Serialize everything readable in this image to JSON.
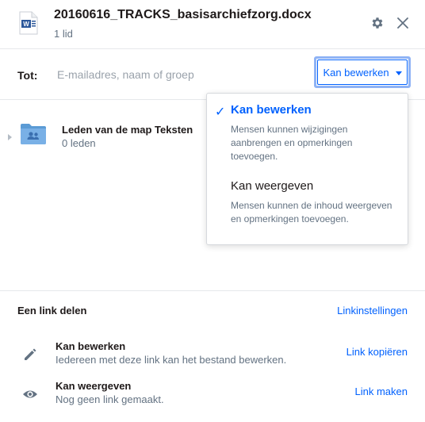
{
  "header": {
    "file_name": "20160616_TRACKS_basisarchiefzorg.docx",
    "member_count": "1 lid",
    "file_icon": "word-doc-icon",
    "word_letter": "W"
  },
  "share": {
    "to_label": "Tot:",
    "input_placeholder": "E-mailadres, naam of groep",
    "input_value": "",
    "permission_selected": "Kan bewerken"
  },
  "members": [
    {
      "name": "Leden van de map Teksten",
      "count": "0 leden",
      "icon": "shared-folder-icon"
    }
  ],
  "permission_menu": {
    "items": [
      {
        "title": "Kan bewerken",
        "description": "Mensen kunnen wijzigingen aanbrengen en opmerkingen toevoegen.",
        "selected": true
      },
      {
        "title": "Kan weergeven",
        "description": "Mensen kunnen de inhoud weergeven en opmerkingen toevoegen.",
        "selected": false
      }
    ]
  },
  "link_share": {
    "heading": "Een link delen",
    "settings_label": "Linkinstellingen",
    "rows": [
      {
        "icon": "pencil-icon",
        "title": "Kan bewerken",
        "description": "Iedereen met deze link kan het bestand bewerken.",
        "action": "Link kopiëren"
      },
      {
        "icon": "eye-icon",
        "title": "Kan weergeven",
        "description": "Nog geen link gemaakt.",
        "action": "Link maken"
      }
    ]
  },
  "colors": {
    "accent": "#0061fe",
    "focus_ring": "#8fb3f5",
    "folder": "#3b7fd4",
    "muted_text": "#637282",
    "divider": "#e6e8eb"
  }
}
